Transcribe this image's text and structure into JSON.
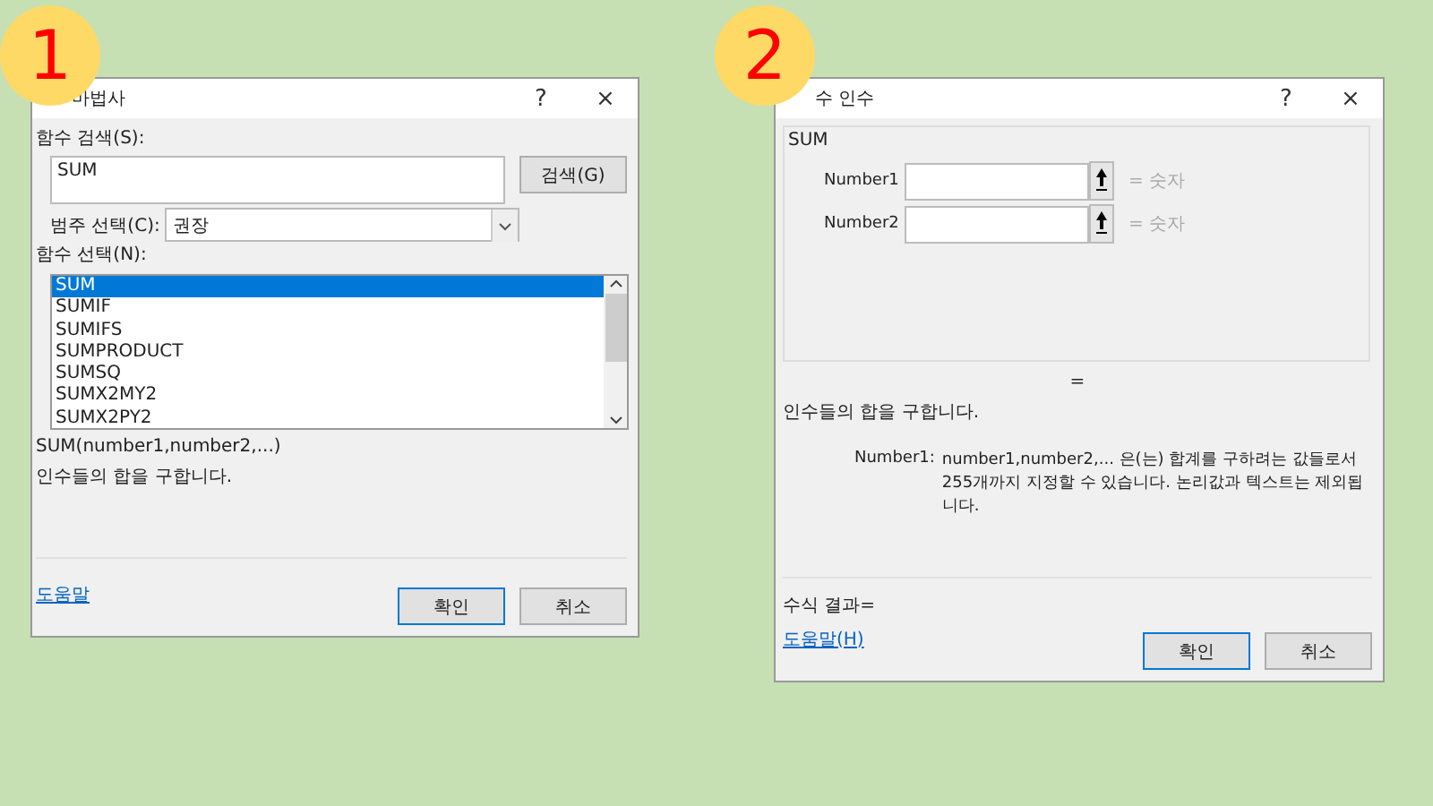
{
  "badges": [
    "1",
    "2"
  ],
  "wizard": {
    "title": "마법사",
    "help_glyph": "?",
    "close_glyph": "×",
    "search_label": "함수 검색(S):",
    "search_value": "SUM",
    "search_button": "검색(G)",
    "category_label": "범주 선택(C):",
    "category_value": "권장",
    "list_label": "함수 선택(N):",
    "functions": [
      {
        "name": "SUM",
        "selected": true
      },
      {
        "name": "SUMIF",
        "selected": false
      },
      {
        "name": "SUMIFS",
        "selected": false
      },
      {
        "name": "SUMPRODUCT",
        "selected": false
      },
      {
        "name": "SUMSQ",
        "selected": false
      },
      {
        "name": "SUMX2MY2",
        "selected": false
      },
      {
        "name": "SUMX2PY2",
        "selected": false
      }
    ],
    "signature": "SUM(number1,number2,...)",
    "description": "인수들의 합을 구합니다.",
    "help_link": "도움말",
    "ok": "확인",
    "cancel": "취소"
  },
  "arguments": {
    "title": "수 인수",
    "help_glyph": "?",
    "close_glyph": "×",
    "group": "SUM",
    "args": [
      {
        "label": "Number1",
        "hint": "= 숫자"
      },
      {
        "label": "Number2",
        "hint": "= 숫자"
      }
    ],
    "result_eq": "=",
    "description": "인수들의 합을 구합니다.",
    "arg_name": "Number1:",
    "arg_text": "number1,number2,... 은(는) 합계를 구하려는 값들로서 255개까지 지정할 수 있습니다. 논리값과 텍스트는 제외됩니다.",
    "formula_result": "수식 결과=",
    "help_link": "도움말(H)",
    "ok": "확인",
    "cancel": "취소"
  }
}
